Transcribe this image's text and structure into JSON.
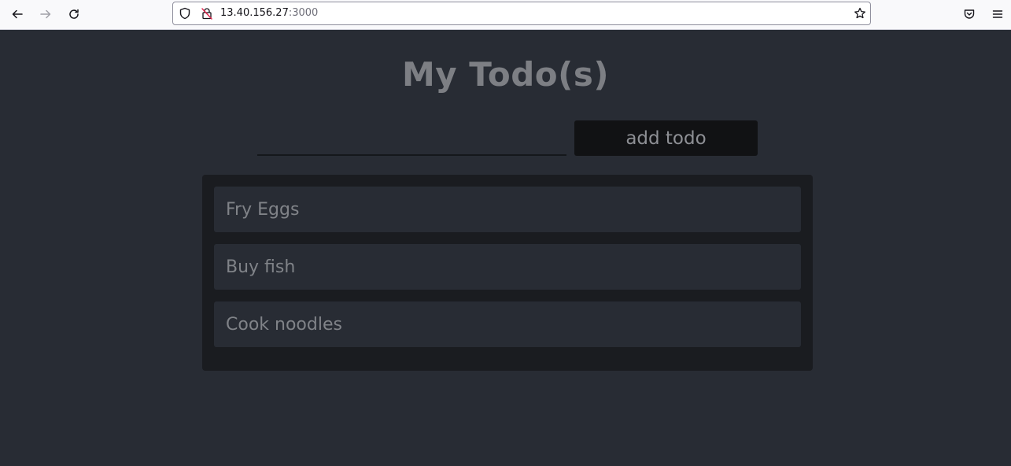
{
  "browser": {
    "url_host": "13.40.156.27",
    "url_port": ":3000",
    "icons": [
      "back-icon",
      "forward-icon",
      "reload-icon",
      "shield-icon",
      "insecure-lock-icon",
      "bookmark-star-icon",
      "pocket-icon",
      "menu-icon"
    ]
  },
  "app": {
    "title": "My Todo(s)",
    "input_value": "",
    "add_button_label": "add todo",
    "todos": [
      {
        "text": "Fry Eggs"
      },
      {
        "text": "Buy fish"
      },
      {
        "text": "Cook noodles"
      }
    ]
  },
  "colors": {
    "background": "#282c34",
    "list_background": "#1a1c20",
    "button_background": "#111214",
    "text": "#808388"
  }
}
